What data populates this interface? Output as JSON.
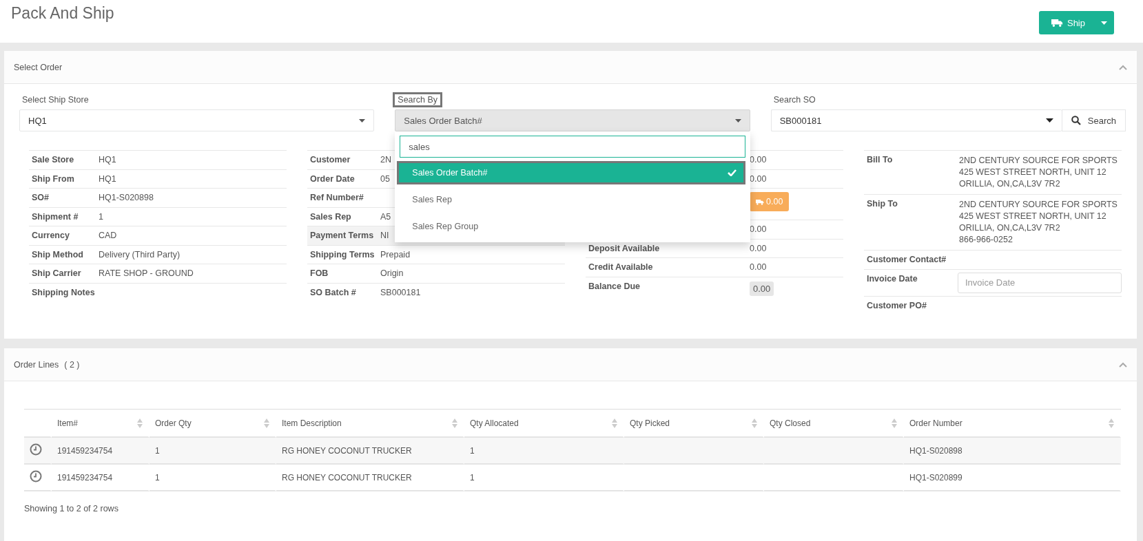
{
  "page": {
    "title": "Pack And Ship",
    "ship_button": {
      "label": "Ship"
    }
  },
  "select_order": {
    "title": "Select Order",
    "expanded": true,
    "fields": [
      {
        "kind": "select",
        "label": "Select Ship Store",
        "value": "HQ1",
        "focused": false
      },
      {
        "kind": "select",
        "label": "Search By",
        "value": "Sales Order Batch#",
        "focused": true
      },
      {
        "kind": "search",
        "label": "Search SO",
        "value": "SB000181",
        "button": "Search",
        "focused": false
      }
    ],
    "dropdown": {
      "search": "sales",
      "options": [
        {
          "label": "Sales Order Batch#",
          "selected": true
        },
        {
          "label": "Sales Rep",
          "selected": false
        },
        {
          "label": "Sales Rep Group",
          "selected": false
        }
      ]
    },
    "detail_columns": [
      {
        "rows": [
          {
            "label": "Sale Store",
            "value": "HQ1",
            "highlighted": false
          },
          {
            "label": "Ship From",
            "value": "HQ1",
            "highlighted": false
          },
          {
            "label": "SO#",
            "value": "HQ1-S020898",
            "highlighted": false
          },
          {
            "label": "Shipment #",
            "value": "1",
            "highlighted": false
          },
          {
            "label": "Currency",
            "value": "CAD",
            "highlighted": false
          },
          {
            "label": "Ship Method",
            "value": "Delivery (Third Party)",
            "highlighted": false
          },
          {
            "label": "Ship Carrier",
            "value": "RATE SHOP - GROUND",
            "highlighted": false
          },
          {
            "label": "Shipping Notes",
            "highlighted": false
          }
        ]
      },
      {
        "rows": [
          {
            "label": "Customer",
            "value": "2N",
            "highlighted": false
          },
          {
            "label": "Order Date",
            "value": "05",
            "highlighted": false
          },
          {
            "label": "Ref Number#",
            "highlighted": false
          },
          {
            "label": "Sales Rep",
            "value": "A5",
            "highlighted": false
          },
          {
            "label": "Payment Terms",
            "value": "NI",
            "highlighted": true
          },
          {
            "label": "Shipping Terms",
            "value": "Prepaid",
            "highlighted": false
          },
          {
            "label": "FOB",
            "value": "Origin",
            "highlighted": false
          },
          {
            "label": "SO Batch #",
            "value": "SB000181",
            "highlighted": false
          }
        ]
      },
      {
        "rows": [
          {
            "kind": "text",
            "value": "0.00",
            "highlighted": false
          },
          {
            "kind": "text",
            "value": "0.00",
            "highlighted": false
          },
          {
            "kind": "shipping-badge",
            "value": "0.00",
            "highlighted": false
          },
          {
            "kind": "text",
            "value": "0.00",
            "highlighted": false
          },
          {
            "kind": "text",
            "label": "Deposit Available",
            "value": "0.00",
            "highlighted": false
          },
          {
            "kind": "text",
            "label": "Credit Available",
            "value": "0.00",
            "highlighted": false
          },
          {
            "kind": "grey-badge",
            "label": "Balance Due",
            "value": "0.00",
            "highlighted": false
          }
        ]
      },
      {
        "rows": [
          {
            "kind": "address",
            "label": "Bill To",
            "lines": [
              "2ND CENTURY SOURCE FOR SPORTS",
              "425 WEST STREET NORTH, UNIT 12",
              "ORILLIA, ON,CA,L3V 7R2"
            ],
            "highlighted": false
          },
          {
            "kind": "address",
            "label": "Ship To",
            "lines": [
              "2ND CENTURY SOURCE FOR SPORTS",
              "425 WEST STREET NORTH, UNIT 12",
              "ORILLIA, ON,CA,L3V 7R2",
              "866-966-0252"
            ],
            "highlighted": false
          },
          {
            "kind": "text",
            "label": "Customer Contact#",
            "highlighted": false
          },
          {
            "kind": "input",
            "label": "Invoice Date",
            "placeholder": "Invoice Date",
            "highlighted": false
          },
          {
            "kind": "text",
            "label": "Customer PO#",
            "highlighted": false
          }
        ]
      }
    ]
  },
  "order_lines": {
    "title": "Order Lines",
    "count": "( 2 )",
    "expanded": true,
    "columns": [
      "Item#",
      "Order Qty",
      "Item Description",
      "Qty Allocated",
      "Qty Picked",
      "Qty Closed",
      "Order Number"
    ],
    "rows": [
      {
        "cells": [
          "191459234754",
          "1",
          "RG HONEY COCONUT TRUCKER",
          "1",
          "",
          "",
          "HQ1-S020898"
        ]
      },
      {
        "cells": [
          "191459234754",
          "1",
          "RG HONEY COCONUT TRUCKER",
          "1",
          "",
          "",
          "HQ1-S020899"
        ]
      }
    ],
    "footer": "Showing 1 to 2 of 2 rows"
  }
}
